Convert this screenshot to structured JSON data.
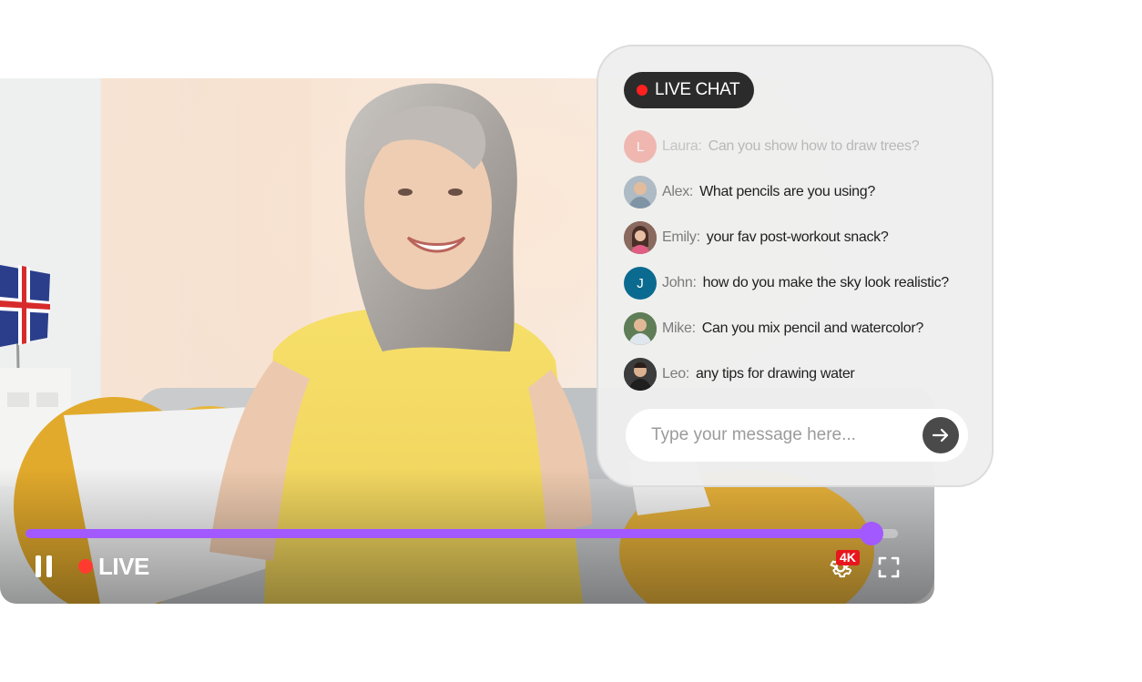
{
  "player": {
    "live_label": "LIVE",
    "quality_badge": "4K",
    "progress_fraction": 0.97,
    "accent_color": "#a259ff",
    "live_color": "#ff3b30",
    "icons": {
      "pause": "pause-icon",
      "settings": "gear-icon",
      "fullscreen": "fullscreen-icon"
    }
  },
  "chat": {
    "header_label": "LIVE CHAT",
    "messages": [
      {
        "author": "Laura:",
        "text": "Can you show how to draw trees?",
        "avatar_initial": "L",
        "avatar_color": "#f08a7f",
        "faded": true
      },
      {
        "author": "Alex:",
        "text": "What pencils are you using?",
        "avatar_initial": "",
        "avatar_color": "#a7b3bd",
        "faded": false
      },
      {
        "author": "Emily:",
        "text": "your fav post-workout snack?",
        "avatar_initial": "",
        "avatar_color": "#7d5b52",
        "faded": false
      },
      {
        "author": "John:",
        "text": "how do you make the sky look realistic?",
        "avatar_initial": "J",
        "avatar_color": "#0b6a8f",
        "faded": false
      },
      {
        "author": "Mike:",
        "text": "Can you mix pencil and watercolor?",
        "avatar_initial": "",
        "avatar_color": "#5c7a55",
        "faded": false
      },
      {
        "author": "Leo:",
        "text": "any tips for drawing water",
        "avatar_initial": "",
        "avatar_color": "#3a3a3a",
        "faded": false
      }
    ],
    "input_placeholder": "Type your message here...",
    "send_icon": "arrow-right-icon"
  }
}
